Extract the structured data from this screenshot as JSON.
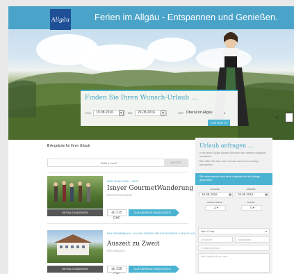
{
  "header": {
    "logo_text": "Allgäu",
    "title": "Ferien im Allgäu - Entspannen und Genießen."
  },
  "search": {
    "title": "Finden Sie Ihren Wunsch-Urlaub ...",
    "from_label": "VON",
    "from_date": "19.08.2016",
    "to_label": "BIS",
    "to_date": "26.08.2016",
    "where_label": "ORT",
    "location": "Überall im Allgäu",
    "go_button": "LOS GEHT'S"
  },
  "offers": {
    "count": "8",
    "heading": "Angebote für Ihren Urlaub",
    "pager_text": "Seite 1 von 2",
    "next_button": "WEITER",
    "items": [
      {
        "location": "ISNY IM ALLGÄU – ISNY",
        "title": "Isnyer GourmetWanderung",
        "subtitle": "FREI PERSON WEISE",
        "details_button": "DETAILS ANZEIGEN",
        "price": "ab 215 CHF",
        "add_button": "ZUR ANFRAGE HINZUFÜGEN"
      },
      {
        "location": "BAD GRÖNENBACH – ALLGÄU RESORT HELIOS BUSINESS & HEALTH HOTEL",
        "title": "Auszeit zu Zweit",
        "subtitle": "FREI 3 NÄCHTE",
        "details_button": "DETAILS ANZEIGEN",
        "price": "ab 238 CHF",
        "add_button": "ZUR ANFRAGE HINZUFÜGEN"
      }
    ]
  },
  "sidebar": {
    "title": "Urlaub anfragen ...",
    "text1": "In der linken Spalte können Sie eines oder mehrere Angebote auswählen.",
    "text2": "Bitte füllen Sie dann das Formular aus um Ihre Anfrage abzusenden.",
    "notice": "Sie haben derzeit noch keine Angebote für die Anfrage gesammelt.",
    "arrival_label": "ANREISE",
    "arrival": "19.08.2016",
    "departure_label": "ABREISE",
    "departure": "26.08.2016",
    "adults_label": "ERWACHSENE",
    "adults": "2",
    "children_label": "KINDER",
    "children": "0",
    "salutation": "Herr / Frau",
    "firstname": "Vorname",
    "lastname": "Nachname",
    "email": "E-Mail Adresse",
    "message": "Ihre Nachricht an uns..."
  }
}
